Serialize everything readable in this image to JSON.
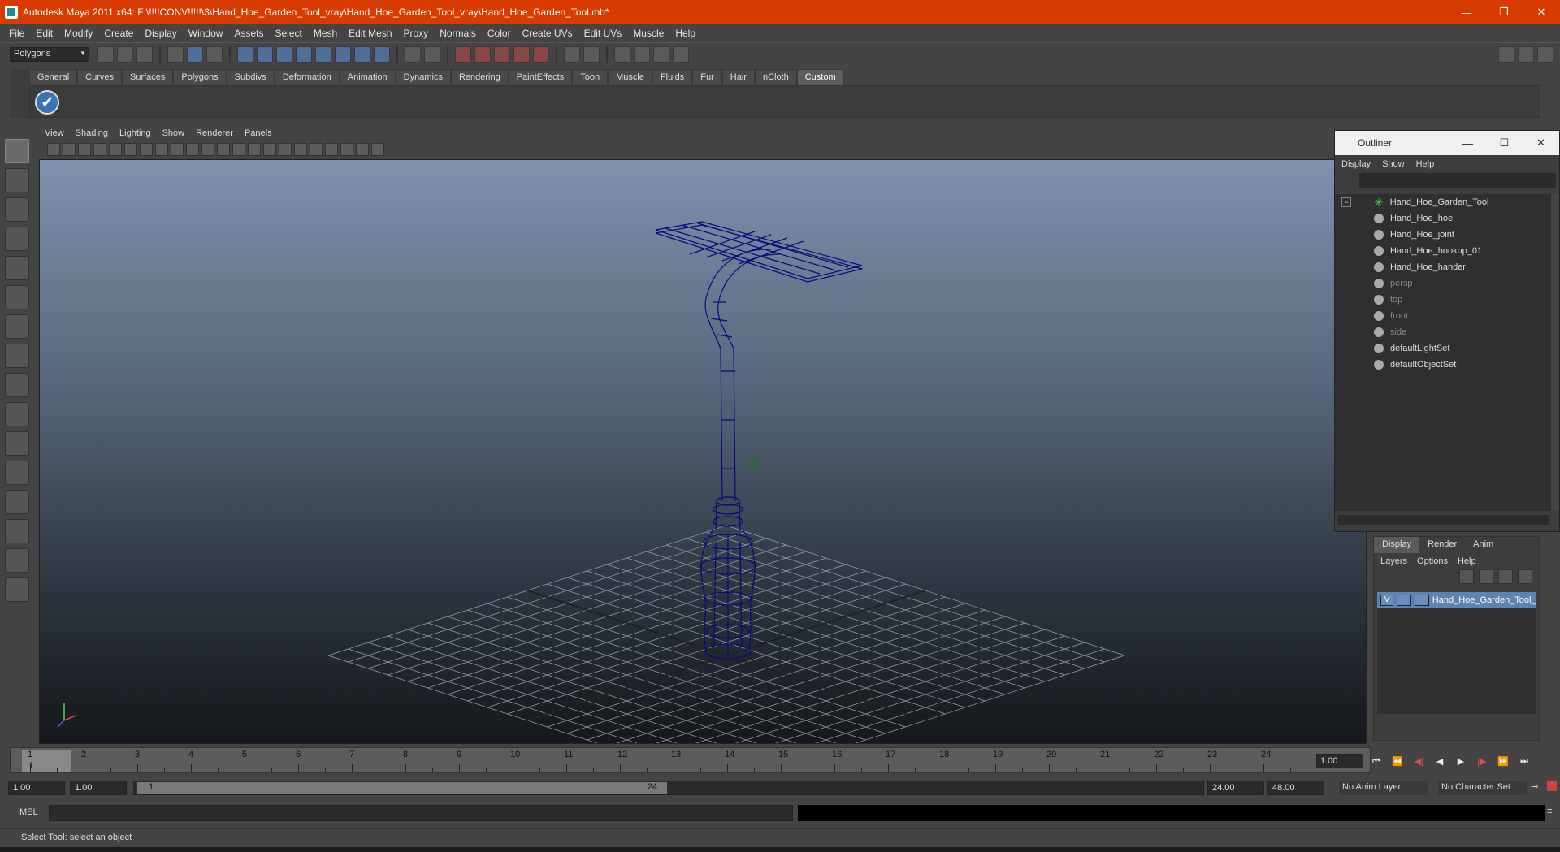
{
  "window": {
    "title": "Autodesk Maya 2011 x64: F:\\!!!!CONV!!!!!\\3\\Hand_Hoe_Garden_Tool_vray\\Hand_Hoe_Garden_Tool_vray\\Hand_Hoe_Garden_Tool.mb*",
    "minimize": "—",
    "restore": "❐",
    "close": "✕"
  },
  "menubar": [
    "File",
    "Edit",
    "Modify",
    "Create",
    "Display",
    "Window",
    "Assets",
    "Select",
    "Mesh",
    "Edit Mesh",
    "Proxy",
    "Normals",
    "Color",
    "Create UVs",
    "Edit UVs",
    "Muscle",
    "Help"
  ],
  "statusline": {
    "mode": "Polygons"
  },
  "shelf": {
    "tabs": [
      "General",
      "Curves",
      "Surfaces",
      "Polygons",
      "Subdivs",
      "Deformation",
      "Animation",
      "Dynamics",
      "Rendering",
      "PaintEffects",
      "Toon",
      "Muscle",
      "Fluids",
      "Fur",
      "Hair",
      "nCloth",
      "Custom"
    ],
    "active_tab": "Custom",
    "check_glyph": "✔"
  },
  "panel": {
    "menu": [
      "View",
      "Shading",
      "Lighting",
      "Show",
      "Renderer",
      "Panels"
    ]
  },
  "outliner": {
    "title": "Outliner",
    "menu": [
      "Display",
      "Show",
      "Help"
    ],
    "items": [
      {
        "label": "Hand_Hoe_Garden_Tool",
        "dim": false
      },
      {
        "label": "Hand_Hoe_hoe",
        "dim": false
      },
      {
        "label": "Hand_Hoe_joint",
        "dim": false
      },
      {
        "label": "Hand_Hoe_hookup_01",
        "dim": false
      },
      {
        "label": "Hand_Hoe_hander",
        "dim": false
      },
      {
        "label": "persp",
        "dim": true
      },
      {
        "label": "top",
        "dim": true
      },
      {
        "label": "front",
        "dim": true
      },
      {
        "label": "side",
        "dim": true
      },
      {
        "label": "defaultLightSet",
        "dim": false
      },
      {
        "label": "defaultObjectSet",
        "dim": false
      }
    ]
  },
  "layers": {
    "tabs": [
      "Display",
      "Render",
      "Anim"
    ],
    "menu": [
      "Layers",
      "Options",
      "Help"
    ],
    "row": {
      "visible": "V",
      "name": "Hand_Hoe_Garden_Tool_"
    }
  },
  "timeslider": {
    "ticks": [
      "1",
      "2",
      "3",
      "4",
      "5",
      "6",
      "7",
      "8",
      "9",
      "10",
      "11",
      "12",
      "13",
      "14",
      "15",
      "16",
      "17",
      "18",
      "19",
      "20",
      "21",
      "22",
      "23",
      "24"
    ],
    "current_frame": "1",
    "current_field": "1.00"
  },
  "range": {
    "start": "1.00",
    "anim_start": "1.00",
    "handle_start": "1",
    "handle_end": "24",
    "end": "24.00",
    "anim_end": "48.00",
    "anim_layer": "No Anim Layer",
    "character_set": "No Character Set"
  },
  "cmdline": {
    "label": "MEL"
  },
  "helpline": {
    "text": "Select Tool: select an object"
  }
}
